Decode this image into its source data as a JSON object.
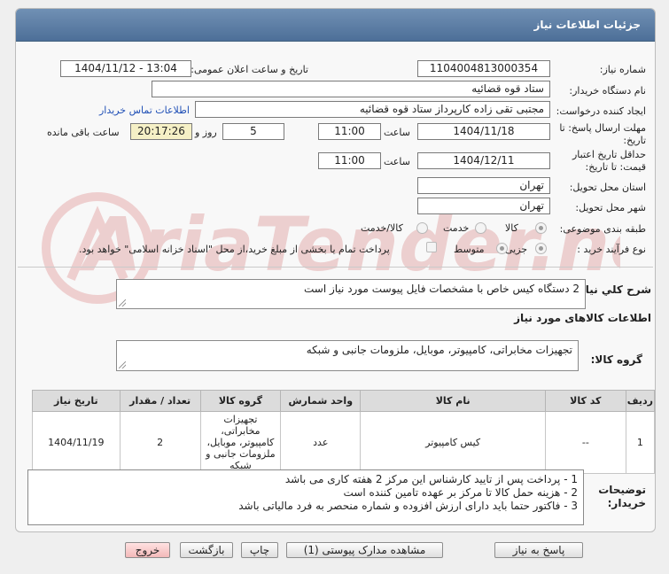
{
  "panel": {
    "title": "جزئیات اطلاعات نیاز"
  },
  "form": {
    "need_number": {
      "label": "شماره نیاز:",
      "value": "1104004813000354"
    },
    "announce_datetime": {
      "label": "تاریخ و ساعت اعلان عمومی:",
      "value": "1404/11/12 - 13:04"
    },
    "buyer_org": {
      "label": "نام دستگاه خریدار:",
      "value": "ستاد قوه قضائیه"
    },
    "requester": {
      "label": "ایجاد کننده درخواست:",
      "value": "مجتبی تقی زاده کارپرداز ستاد قوه قضائیه",
      "contact_link": "اطلاعات تماس خریدار"
    },
    "reply_deadline": {
      "label_line1": "مهلت ارسال پاسخ: تا",
      "label_line2": "تاریخ:",
      "date": "1404/11/18",
      "time_label": "ساعت",
      "time": "11:00",
      "days": "5",
      "days_label": "روز و",
      "remaining": "20:17:26",
      "remaining_label": "ساعت باقی مانده"
    },
    "price_validity": {
      "label_line1": "حداقل تاریخ اعتبار",
      "label_line2": "قیمت: تا تاریخ:",
      "date": "1404/12/11",
      "time_label": "ساعت",
      "time": "11:00"
    },
    "delivery_province": {
      "label": "استان محل تحویل:",
      "value": "تهران"
    },
    "delivery_city": {
      "label": "شهر محل تحویل:",
      "value": "تهران"
    },
    "category": {
      "label": "طبقه بندی موضوعی:",
      "options": [
        "کالا",
        "خدمت",
        "کالا/خدمت"
      ],
      "selected": "کالا"
    },
    "purchase_process": {
      "label": "نوع فرآیند خرید :",
      "options": [
        "جزیی",
        "متوسط"
      ],
      "selected": "جزیی",
      "checkbox_label": "پرداخت تمام یا بخشی از مبلغ خرید،از محل \"اسناد خزانه اسلامی\" خواهد بود."
    }
  },
  "general_description": {
    "label": "شرح کلي نياز:",
    "value": "2 دستگاه کیس خاص با مشخصات فایل پیوست مورد نیاز است"
  },
  "goods_info": {
    "heading": "اطلاعات کالاهای مورد نیاز"
  },
  "goods_group": {
    "label": "گروه کالا:",
    "value": "تجهیزات مخابراتی، کامپیوتر، موبایل، ملزومات جانبی و شبکه"
  },
  "table": {
    "headers": [
      "ردیف",
      "کد کالا",
      "نام کالا",
      "واحد شمارش",
      "گروه کالا",
      "تعداد / مقدار",
      "تاریخ نیاز"
    ],
    "rows": [
      {
        "row": "1",
        "code": "--",
        "name": "کیس کامپیوتر",
        "unit": "عدد",
        "group": "تجهیزات مخابراتی، کامپیوتر، موبایل، ملزومات جانبی و شبکه",
        "quantity": "2",
        "date": "1404/11/19"
      }
    ]
  },
  "buyer_notes": {
    "label_line1": "توضیحات",
    "label_line2": "خریدار:",
    "lines": [
      "1 - پرداخت پس از تایید کارشناس این مرکز 2 هفته کاری می باشد",
      "2 - هزینه حمل کالا تا مرکز بر عهده تامین کننده است",
      "3 -  فاکتور حتما باید دارای ارزش افزوده و شماره منحصر به فرد مالیاتی باشد"
    ]
  },
  "buttons": {
    "reply": "پاسخ به نیاز",
    "attachments": "مشاهده مدارک پیوستی (1)",
    "print": "چاپ",
    "back": "بازگشت",
    "exit": "خروج"
  },
  "watermark": {
    "text": "AriaTender.net"
  }
}
